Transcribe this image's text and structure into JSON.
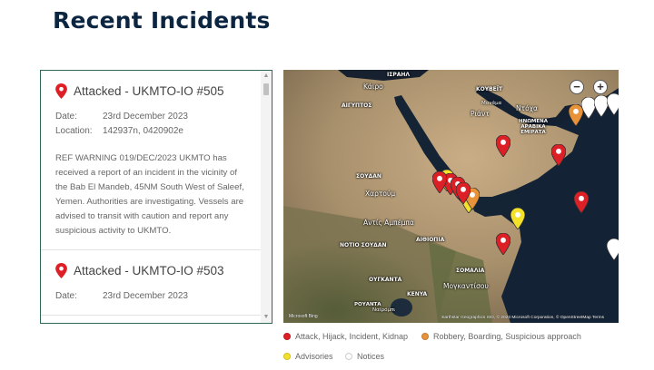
{
  "page": {
    "title": "Recent Incidents"
  },
  "incidents": [
    {
      "title": "Attacked - UKMTO-IO #505",
      "date_label": "Date:",
      "date": "23rd December 2023",
      "location_label": "Location:",
      "location": "142937n, 0420902e",
      "description": "REF WARNING 019/DEC/2023 UKMTO has received a report of an incident in the vicinity of the Bab El Mandeb, 45NM South West of Saleef, Yemen. Authorities are investigating. Vessels are advised to transit with caution and report any suspicious activity to UKMTO."
    },
    {
      "title": "Attacked - UKMTO-IO #503",
      "date_label": "Date:",
      "date": "23rd December 2023"
    }
  ],
  "map": {
    "zoom_out": "−",
    "zoom_in": "+",
    "logo": "Microsoft Bing",
    "attribution": "Earthstar Geographics SIO, © 2023 Microsoft Corporation, © OpenStreetMap  Terms",
    "labels": {
      "egypt": "ΑΙΓΥΠΤΟΣ",
      "cairo": "Κάιρο",
      "israel": "ΙΣΡΑΗΛ",
      "kuwait": "ΚΟΥΒΕΪΤ",
      "manama": "Μανάμα",
      "riyadh": "Ριάντ",
      "doha": "Ντόχα",
      "uae": "ΗΝΩΜΕΝΑ ΑΡΑΒΙΚΑ ΕΜΙΡΑΤΑ",
      "sudan": "ΣΟΥΔΑΝ",
      "khartoum": "Χαρτούμ",
      "addis": "Αντίς Αμπέμπα",
      "south_sudan": "ΝΟΤΙΟ ΣΟΥΔΑΝ",
      "ethiopia": "ΑΙΘΙΟΠΙΑ",
      "somalia": "ΣΟΜΑΛΙΑ",
      "uganda": "ΟΥΓΚΑΝΤΑ",
      "mogadishu": "Μογκαντίσου",
      "kenya": "KENYA",
      "rwanda": "ΡΟΥΑΝΤΑ",
      "nairobi": "Ναϊρόμπι"
    },
    "colors": {
      "attack": "#dd1f26",
      "robbery": "#e8923a",
      "advisory": "#f4e22a",
      "notice": "#ffffff"
    }
  },
  "legend": [
    {
      "label": "Attack, Hijack, Incident, Kidnap",
      "color": "#dd1f26"
    },
    {
      "label": "Robbery, Boarding, Suspicious approach",
      "color": "#e8923a"
    },
    {
      "label": "Advisories",
      "color": "#f4e22a"
    },
    {
      "label": "Notices",
      "color": "#ffffff"
    }
  ]
}
